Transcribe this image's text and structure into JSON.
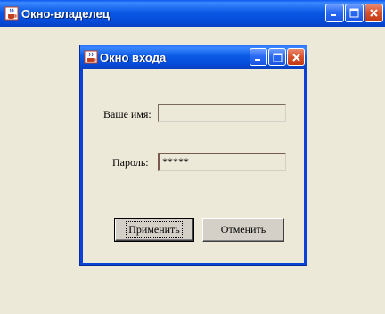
{
  "owner_window": {
    "title": "Окно-владелец",
    "icon": "java-cup-icon",
    "controls": {
      "minimize": "minimize-icon",
      "maximize": "maximize-icon",
      "close": "close-icon"
    }
  },
  "login_dialog": {
    "title": "Окно входа",
    "icon": "java-cup-icon",
    "controls": {
      "minimize": "minimize-icon",
      "maximize": "maximize-icon",
      "close": "close-icon"
    },
    "username": {
      "label": "Ваше имя:",
      "value": ""
    },
    "password": {
      "label": "Пароль:",
      "value": "*****"
    },
    "apply_button": "Применить",
    "cancel_button": "Отменить"
  },
  "colors": {
    "titlebar_blue": "#0449d6",
    "close_red": "#d9512a",
    "face": "#ece9d8"
  }
}
